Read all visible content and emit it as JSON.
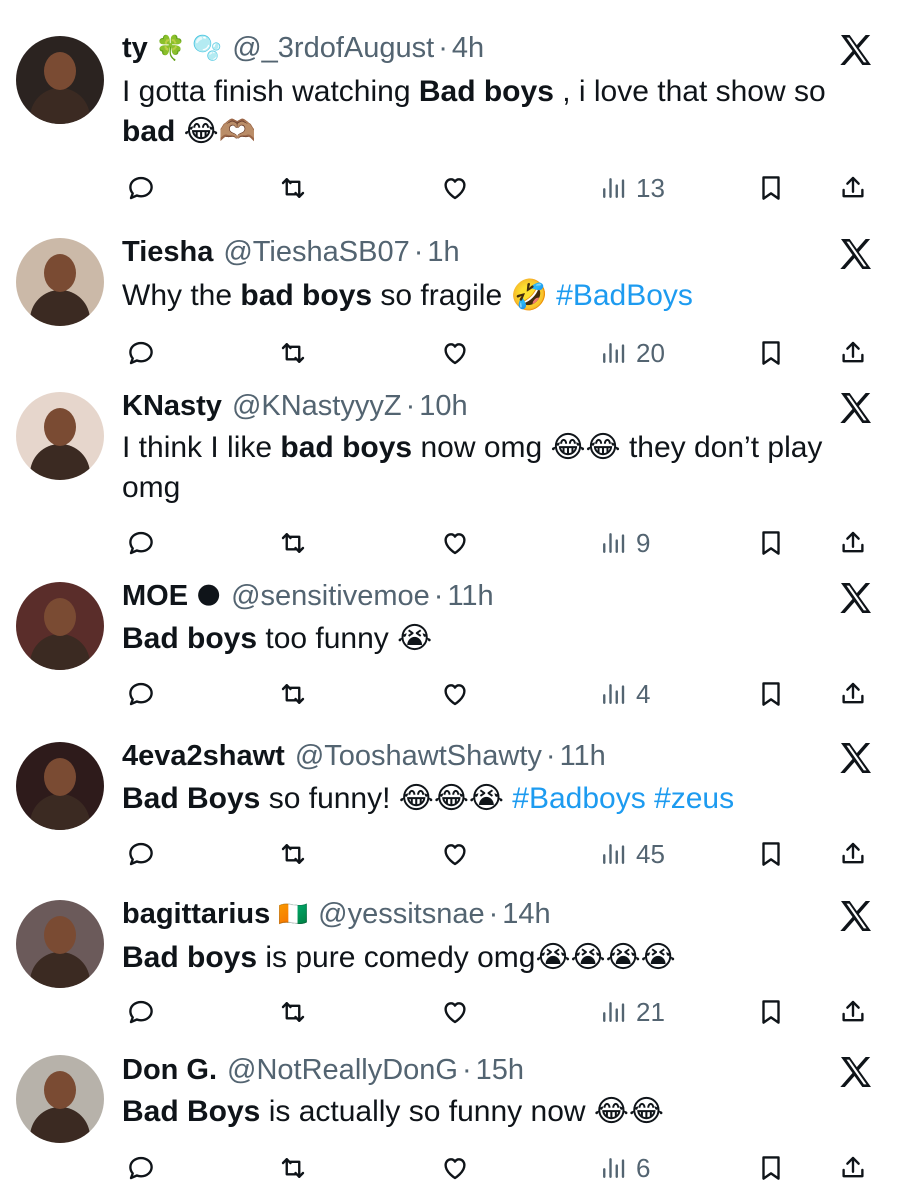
{
  "tweets": [
    {
      "name": "ty",
      "badge": "🍀 🫧",
      "handle": "@_3rdofAugust",
      "time": "4h",
      "segments": [
        {
          "t": "I gotta finish watching "
        },
        {
          "t": "Bad boys",
          "b": true
        },
        {
          "t": " , i love that show so "
        },
        {
          "t": "bad",
          "b": true
        },
        {
          "t": " 😂🫶🏽"
        }
      ],
      "views": "13"
    },
    {
      "name": "Tiesha",
      "badge": "",
      "handle": "@TieshaSB07",
      "time": "1h",
      "segments": [
        {
          "t": "Why the "
        },
        {
          "t": "bad boys",
          "b": true
        },
        {
          "t": " so fragile 🤣 "
        },
        {
          "t": "#BadBoys",
          "tag": true
        }
      ],
      "views": "20"
    },
    {
      "name": "KNasty",
      "badge": "",
      "handle": "@KNastyyyZ",
      "time": "10h",
      "segments": [
        {
          "t": "I think I like "
        },
        {
          "t": "bad boys",
          "b": true
        },
        {
          "t": " now omg 😂😂 they don’t play omg"
        }
      ],
      "views": "9"
    },
    {
      "name": "MOE",
      "badge": "🌑",
      "handle": "@sensitivemoe",
      "time": "11h",
      "segments": [
        {
          "t": "Bad boys",
          "b": true
        },
        {
          "t": " too funny 😭"
        }
      ],
      "views": "4"
    },
    {
      "name": "4eva2shawt",
      "badge": "",
      "handle": "@TooshawtShawty",
      "time": "11h",
      "segments": [
        {
          "t": "Bad Boys",
          "b": true
        },
        {
          "t": " so funny! 😂😂😭 "
        },
        {
          "t": "#Badboys #zeus",
          "tag": true
        }
      ],
      "views": "45"
    },
    {
      "name": "bagittarius",
      "badge": "🇨🇮",
      "handle": "@yessitsnae",
      "time": "14h",
      "segments": [
        {
          "t": "Bad boys",
          "b": true
        },
        {
          "t": " is pure comedy omg😭😭😭😭"
        }
      ],
      "views": "21"
    },
    {
      "name": "Don G.",
      "badge": "",
      "handle": "@NotReallyDonG",
      "time": "15h",
      "segments": [
        {
          "t": "Bad Boys",
          "b": true
        },
        {
          "t": " is actually so funny now 😂😂"
        }
      ],
      "views": "6"
    }
  ],
  "colors": {
    "text": "#0f1419",
    "muted": "#536471",
    "link": "#1d9bf0"
  },
  "icons": {
    "platform": "x-logo-icon",
    "reply": "reply-icon",
    "retweet": "retweet-icon",
    "like": "heart-icon",
    "views": "views-bar-icon",
    "bookmark": "bookmark-icon",
    "share": "share-icon"
  }
}
